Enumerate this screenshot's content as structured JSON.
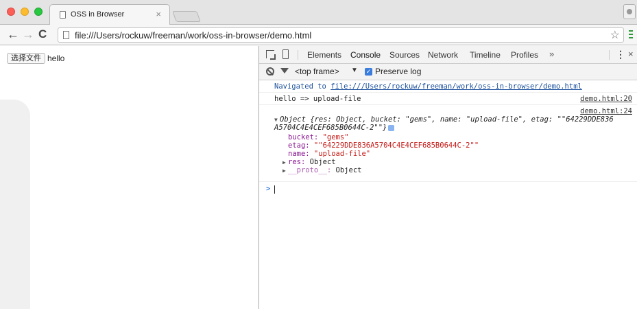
{
  "browser": {
    "tab_title": "OSS in Browser",
    "tab_close": "×",
    "url": "file:///Users/rockuw/freeman/work/oss-in-browser/demo.html",
    "nav_back": "←",
    "nav_forward": "→",
    "nav_reload": "C",
    "star": "☆"
  },
  "page": {
    "file_button_label": "选择文件",
    "file_name": "hello"
  },
  "devtools": {
    "tabs": [
      "Elements",
      "Console",
      "Sources",
      "Network",
      "Timeline",
      "Profiles"
    ],
    "active_tab": "Console",
    "more": "»",
    "kebab": "⋮",
    "close": "×",
    "context": "<top frame>",
    "context_arrow": "▼",
    "preserve_log": "Preserve log"
  },
  "console": {
    "nav_prefix": "Navigated to ",
    "nav_url": "file:///Users/rockuw/freeman/work/oss-in-browser/demo.html",
    "line1_text": "hello => upload-file",
    "line1_src": "demo.html:20",
    "line2_src": "demo.html:24",
    "obj_summary_1": "Object {res: Object, bucket: \"gems\", name: \"upload-file\", etag: \"\"64229DDE836",
    "obj_summary_2": "A5704C4E4CEF685B0644C-2\"\"}",
    "bucket_key": "bucket:",
    "bucket_val": " \"gems\"",
    "etag_key": "etag:",
    "etag_val": " \"\"64229DDE836A5704C4E4CEF685B0644C-2\"\"",
    "name_key": "name:",
    "name_val": " \"upload-file\"",
    "res_key": "res:",
    "res_val": " Object",
    "proto_key": "__proto__:",
    "proto_val": " Object",
    "prompt": ">"
  },
  "colors": {
    "close": "#fc5f57",
    "minimize": "#fdbc2e",
    "maximize": "#28c840",
    "link_blue": "#1a4f9c",
    "key_purple": "#881391",
    "string_red": "#c41a16"
  }
}
